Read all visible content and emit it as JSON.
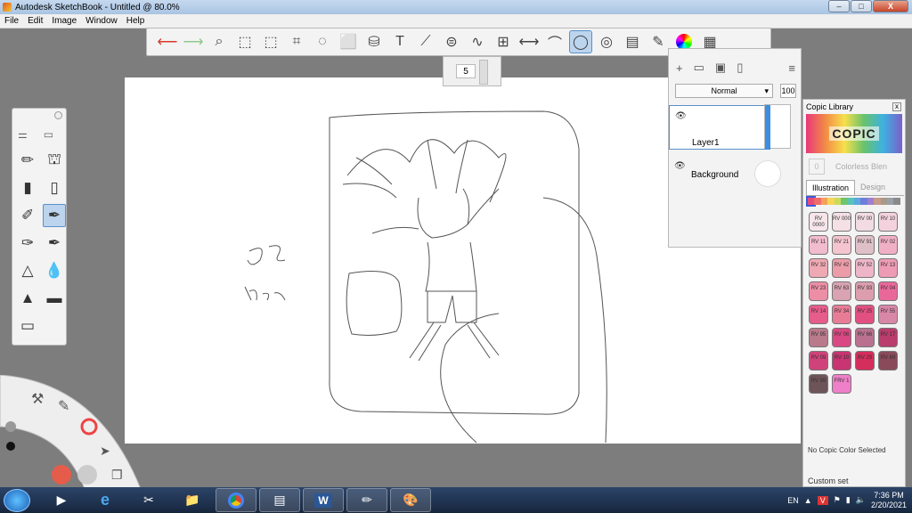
{
  "window": {
    "title": "Autodesk SketchBook - Untitled @ 80.0%",
    "min": "–",
    "max": "□",
    "close": "X"
  },
  "menu": [
    "File",
    "Edit",
    "Image",
    "Window",
    "Help"
  ],
  "toolbar": {
    "icons": [
      "undo-icon",
      "redo-icon",
      "zoom-icon",
      "select-icon",
      "crop-select-icon",
      "crop-icon",
      "lasso-icon",
      "transform-icon",
      "bucket-icon",
      "text-icon",
      "ruler-icon",
      "ellipse-icon",
      "french-curve-icon",
      "perspective-icon",
      "symmetry-icon",
      "stroke-icon",
      "predictive-icon",
      "copic-icon",
      "layer-editor-icon",
      "brush-palette-icon",
      "color-wheel-icon",
      "swatches-icon"
    ]
  },
  "brush_size": {
    "value": "5"
  },
  "layers": {
    "blend_mode": "Normal",
    "opacity": "100",
    "items": [
      {
        "name": "Layer1"
      },
      {
        "name": "Background"
      }
    ]
  },
  "copic": {
    "title": "Copic Library",
    "logo": "COPIC",
    "colorless": "Colorless Blen",
    "colorless_code": "0",
    "tabs": [
      "Illustration",
      "Design"
    ],
    "no_color": "No Copic Color Selected",
    "custom": "Custom set",
    "swatches": [
      {
        "code": "RV 0000",
        "color": "#f6e6ea"
      },
      {
        "code": "RV 000",
        "color": "#f4e0e5"
      },
      {
        "code": "RV 00",
        "color": "#f2dbe2"
      },
      {
        "code": "RV 10",
        "color": "#f4d2dd"
      },
      {
        "code": "RV 11",
        "color": "#f1bccd"
      },
      {
        "code": "RV 21",
        "color": "#f4c5cf"
      },
      {
        "code": "RV 91",
        "color": "#e0c0c8"
      },
      {
        "code": "RV 02",
        "color": "#f1afc5"
      },
      {
        "code": "RV 32",
        "color": "#eea9b3"
      },
      {
        "code": "RV 42",
        "color": "#eb9ca8"
      },
      {
        "code": "RV 52",
        "color": "#eeb5c8"
      },
      {
        "code": "RV 13",
        "color": "#ee9bb5"
      },
      {
        "code": "RV 23",
        "color": "#ec8fa6"
      },
      {
        "code": "RV 63",
        "color": "#d9a3b1"
      },
      {
        "code": "RV 93",
        "color": "#dc9eae"
      },
      {
        "code": "RV 04",
        "color": "#e9689a"
      },
      {
        "code": "RV 14",
        "color": "#e65c8a"
      },
      {
        "code": "RV 34",
        "color": "#e87c96"
      },
      {
        "code": "RV 25",
        "color": "#e24f81"
      },
      {
        "code": "RV 55",
        "color": "#d987a6"
      },
      {
        "code": "RV 95",
        "color": "#b97a8c"
      },
      {
        "code": "RV 06",
        "color": "#d94882"
      },
      {
        "code": "RV 66",
        "color": "#b9718f"
      },
      {
        "code": "RV 17",
        "color": "#b93d6d"
      },
      {
        "code": "RV 09",
        "color": "#d0437a"
      },
      {
        "code": "RV 19",
        "color": "#c93472"
      },
      {
        "code": "RV 29",
        "color": "#d52d5c"
      },
      {
        "code": "RV 69",
        "color": "#8a4a5a"
      },
      {
        "code": "RV 99",
        "color": "#6d5458"
      },
      {
        "code": "FRV 1",
        "color": "#ef7fc8"
      }
    ]
  },
  "taskbar": {
    "lang": "EN",
    "time": "7:36 PM",
    "date": "2/20/2021"
  },
  "canvas": {
    "sketch_text": [
      "ae",
      "ham"
    ]
  }
}
